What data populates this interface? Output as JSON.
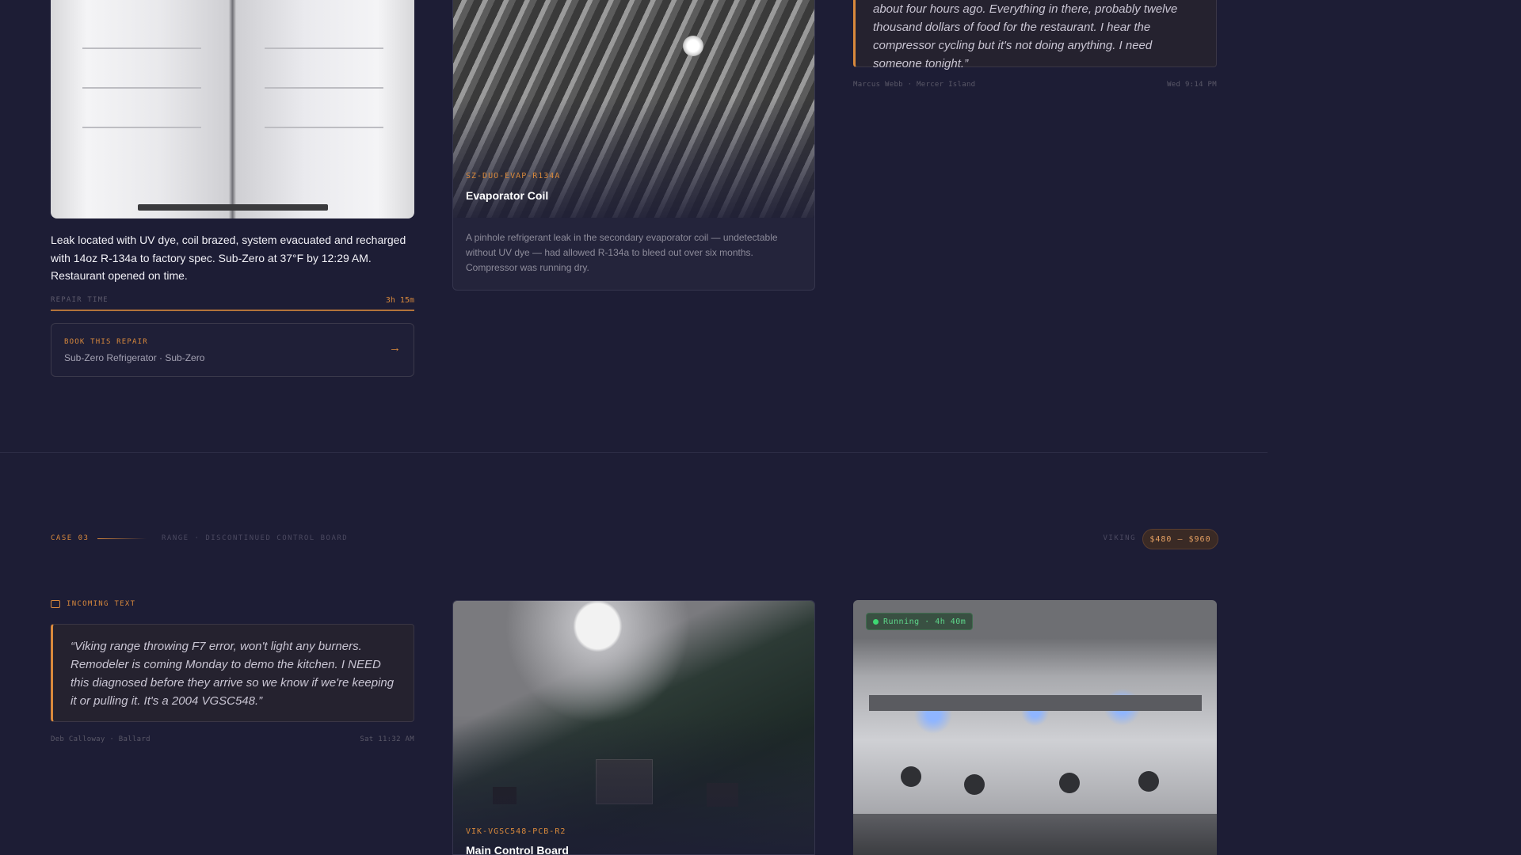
{
  "case_sub_zero": {
    "summary": "Leak located with UV dye, coil brazed, system evacuated and recharged with 14oz R-134a to factory spec. Sub-Zero at 37°F by 12:29 AM. Restaurant opened on time.",
    "repair_time_label": "REPAIR TIME",
    "repair_time_value": "3h 15m",
    "book_label": "BOOK THIS REPAIR",
    "book_subtitle": "Sub-Zero Refrigerator · Sub-Zero",
    "part": {
      "code": "SZ-DUO-EVAP-R134A",
      "name": "Evaporator Coil",
      "description": "A pinhole refrigerant leak in the secondary evaporator coil — undetectable without UV dye — had allowed R-134a to bleed out over six months. Compressor was running dry."
    },
    "quote": {
      "text": "about four hours ago. Everything in there, probably twelve thousand dollars of food for the restaurant. I hear the compressor cycling but it's not doing anything. I need someone tonight.”",
      "author": "Marcus Webb · Mercer Island",
      "time": "Wed 9:14 PM"
    }
  },
  "case_03": {
    "case_label": "CASE 03",
    "case_subtitle": "RANGE · DISCONTINUED CONTROL BOARD",
    "brand": "VIKING",
    "price_range": "$480 – $960",
    "incoming_label": "INCOMING TEXT",
    "quote": {
      "text": "“Viking range throwing F7 error, won't light any burners. Remodeler is coming Monday to demo the kitchen. I NEED this diagnosed before they arrive so we know if we're keeping it or pulling it. It's a 2004 VGSC548.”",
      "author": "Deb Calloway · Ballard",
      "time": "Sat 11:32 AM"
    },
    "part": {
      "code": "VIK-VGSC548-PCB-R2",
      "name": "Main Control Board"
    },
    "status": {
      "label": "Running · 4h 40m"
    }
  },
  "icons": {
    "arrow": "arrow-right-icon",
    "message": "message-icon",
    "status_dot": "status-dot-icon"
  },
  "colors": {
    "accent": "#d9893c",
    "background": "#1d1d35",
    "running": "#3ed873"
  }
}
